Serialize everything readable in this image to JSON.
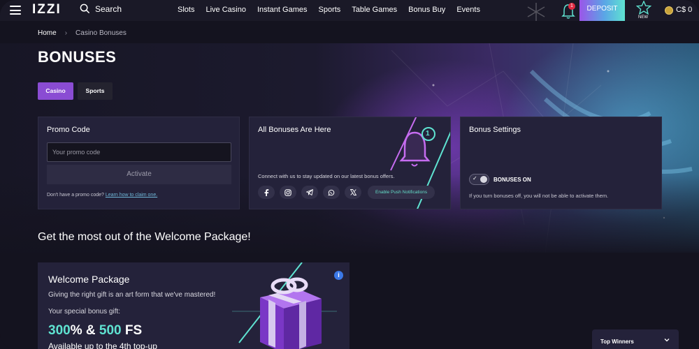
{
  "header": {
    "logo": "IZZI",
    "search_label": "Search",
    "nav": [
      "Slots",
      "Live Casino",
      "Instant Games",
      "Sports",
      "Table Games",
      "Bonus Buy",
      "Events"
    ],
    "notification_count": "1",
    "deposit_label": "DEPOSIT",
    "new_label": "NEW",
    "currency": "C$ 0"
  },
  "breadcrumb": {
    "home": "Home",
    "current": "Casino Bonuses"
  },
  "page_title": "BONUSES",
  "tabs": {
    "casino": "Casino",
    "sports": "Sports"
  },
  "promo_card": {
    "title": "Promo Code",
    "placeholder": "Your promo code",
    "activate_label": "Activate",
    "no_code_text": "Don't have a promo code?",
    "learn_link": "Learn how to claim one."
  },
  "bonuses_card": {
    "title": "All Bonuses Are Here",
    "connect_text": "Connect with us to stay updated on our latest bonus offers.",
    "socials": [
      "facebook-icon",
      "instagram-icon",
      "telegram-icon",
      "whatsapp-icon",
      "x-icon"
    ],
    "bell_badge": "1",
    "push_label": "Enable Push Notifications"
  },
  "settings_card": {
    "title": "Bonus Settings",
    "toggle_label": "BONUSES ON",
    "toggle_on": true,
    "note": "If you turn bonuses off, you will not be able to activate them."
  },
  "welcome_heading": "Get the most out of the Welcome Package!",
  "welcome_package": {
    "title": "Welcome Package",
    "description": "Giving the right gift is an art form that we've mastered!",
    "gift_label": "Your special bonus gift:",
    "percent": "300",
    "percent_suffix": "% & ",
    "fs": "500",
    "fs_suffix": " FS",
    "subtitle": "Available up to the 4th top-up",
    "info_icon": "i"
  },
  "top_winners": {
    "label": "Top Winners"
  },
  "colors": {
    "accent_purple": "#8a4cd3",
    "accent_teal": "#5fe3d1",
    "card_bg": "#24223a",
    "page_bg": "#14131f"
  }
}
